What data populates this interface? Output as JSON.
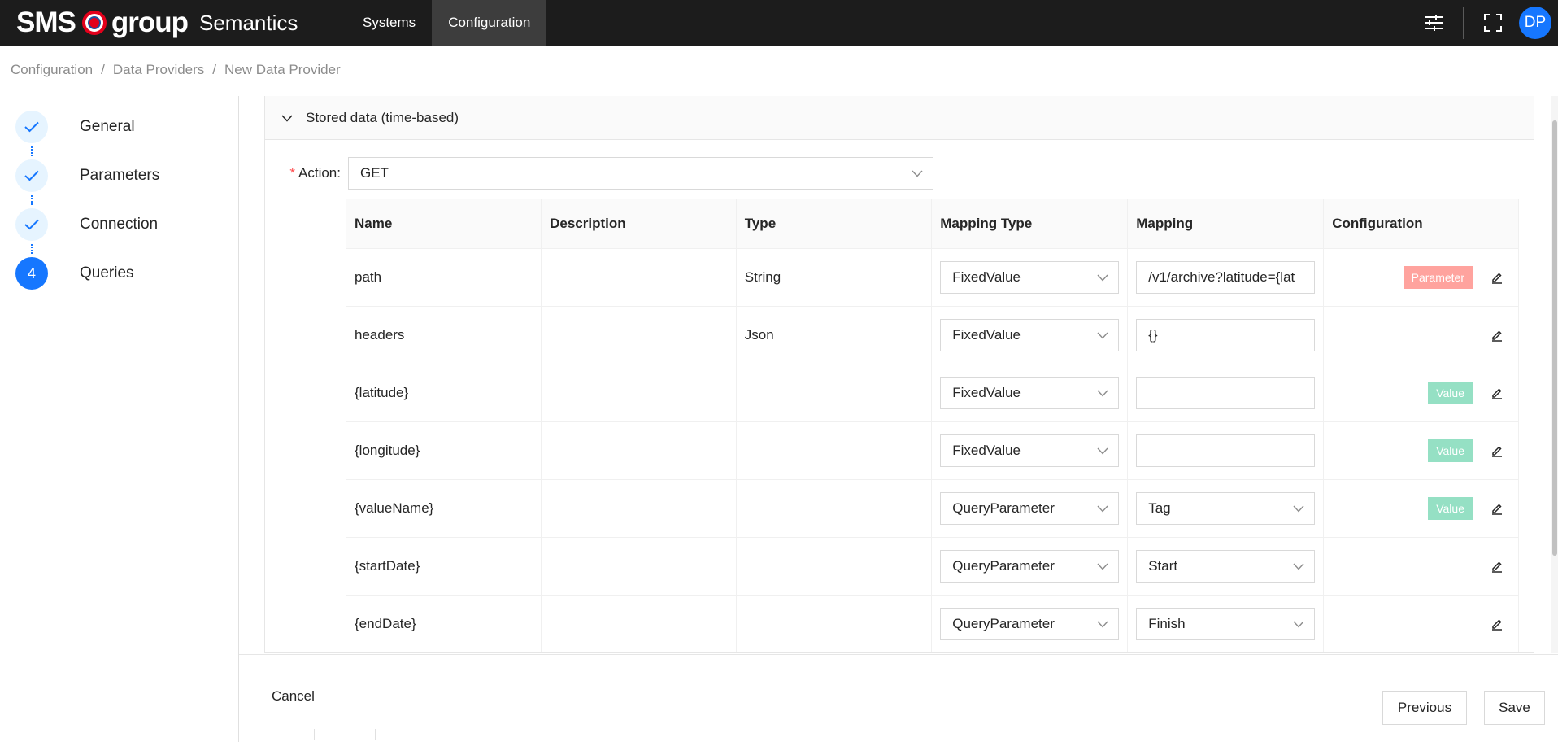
{
  "header": {
    "logo_sms": "SMS",
    "logo_group": "group",
    "app_name": "Semantics",
    "nav": [
      {
        "label": "Systems",
        "active": false
      },
      {
        "label": "Configuration",
        "active": true
      }
    ],
    "avatar_initials": "DP",
    "icons": [
      "sliders-icon",
      "fullscreen-icon"
    ]
  },
  "breadcrumb": [
    "Configuration",
    "Data Providers",
    "New Data Provider"
  ],
  "steps": [
    {
      "label": "General",
      "status": "done"
    },
    {
      "label": "Parameters",
      "status": "done"
    },
    {
      "label": "Connection",
      "status": "done"
    },
    {
      "label": "Queries",
      "status": "current",
      "number": "4"
    }
  ],
  "section": {
    "title": "Stored data (time-based)",
    "action_label": "Action",
    "action_value": "GET"
  },
  "table": {
    "columns": [
      "Name",
      "Description",
      "Type",
      "Mapping Type",
      "Mapping",
      "Configuration"
    ],
    "rows": [
      {
        "name": "path",
        "description": "",
        "type": "String",
        "mapping_type": "FixedValue",
        "mapping": "/v1/archive?latitude={lat",
        "mapping_kind": "input",
        "tag": "Parameter"
      },
      {
        "name": "headers",
        "description": "",
        "type": "Json",
        "mapping_type": "FixedValue",
        "mapping": "{}",
        "mapping_kind": "input",
        "tag": ""
      },
      {
        "name": "{latitude}",
        "description": "",
        "type": "",
        "mapping_type": "FixedValue",
        "mapping": "",
        "mapping_kind": "input",
        "tag": "Value"
      },
      {
        "name": "{longitude}",
        "description": "",
        "type": "",
        "mapping_type": "FixedValue",
        "mapping": "",
        "mapping_kind": "input",
        "tag": "Value"
      },
      {
        "name": "{valueName}",
        "description": "",
        "type": "",
        "mapping_type": "QueryParameter",
        "mapping": "Tag",
        "mapping_kind": "select",
        "tag": "Value"
      },
      {
        "name": "{startDate}",
        "description": "",
        "type": "",
        "mapping_type": "QueryParameter",
        "mapping": "Start",
        "mapping_kind": "select",
        "tag": ""
      },
      {
        "name": "{endDate}",
        "description": "",
        "type": "",
        "mapping_type": "QueryParameter",
        "mapping": "Finish",
        "mapping_kind": "select",
        "tag": ""
      }
    ]
  },
  "footer": {
    "cancel": "Cancel",
    "previous": "Previous",
    "save": "Save"
  },
  "colors": {
    "topbar": "#1c1c1c",
    "accent": "#1677ff",
    "tag_parameter": "#ffa39e",
    "tag_value": "#95e0c4"
  }
}
